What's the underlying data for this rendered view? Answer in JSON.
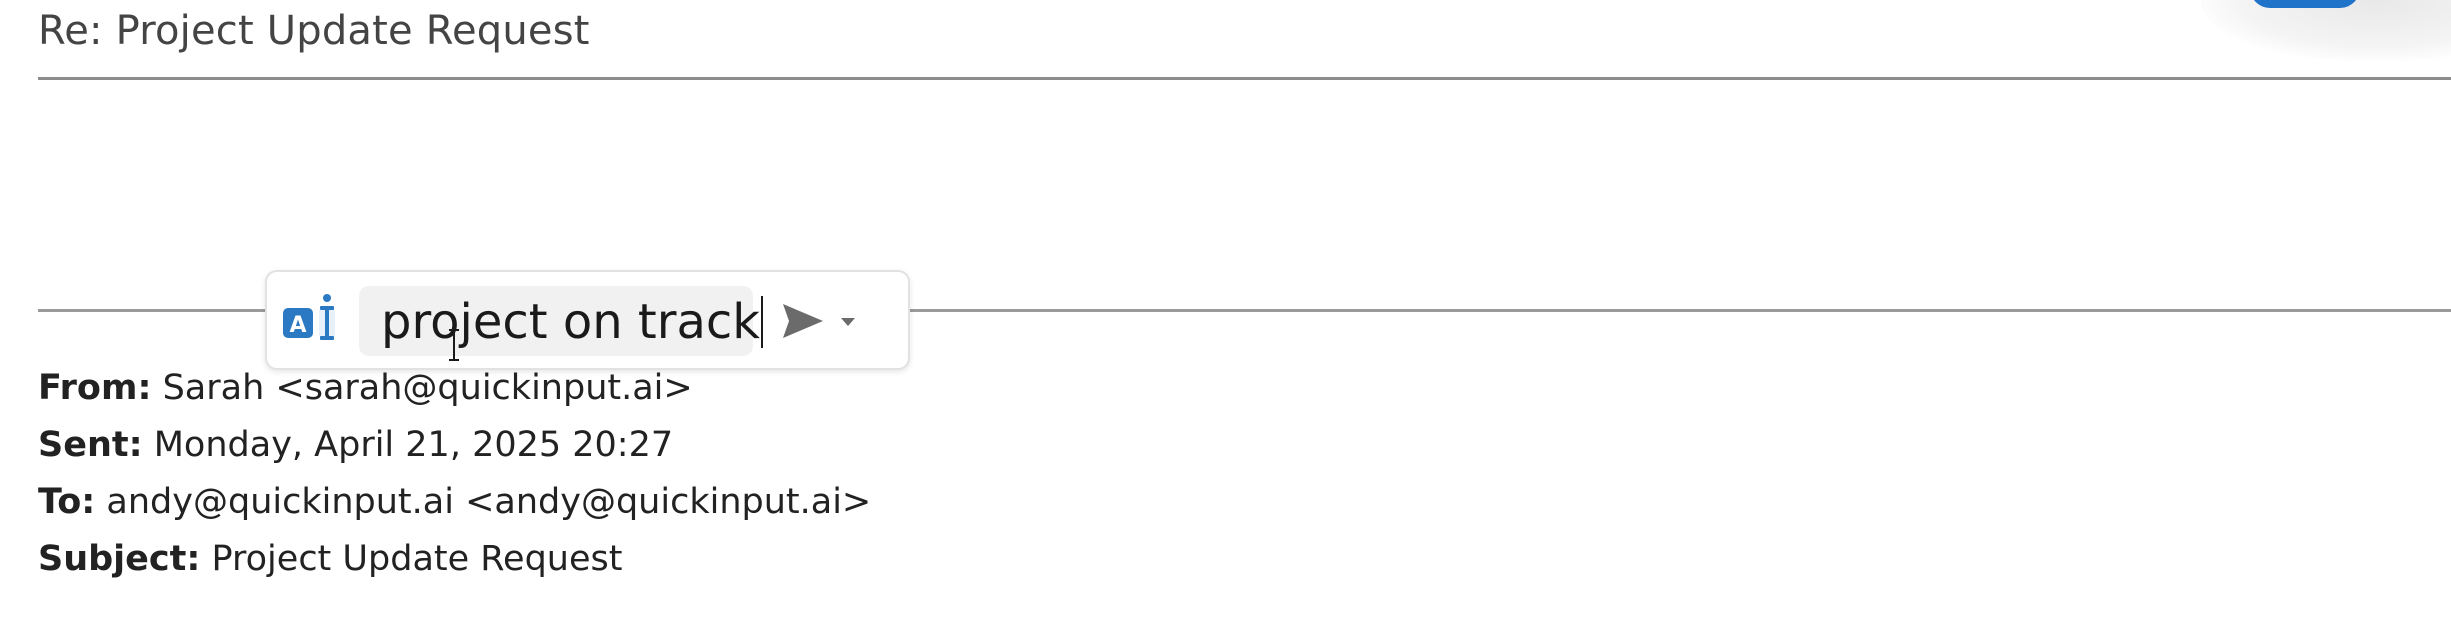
{
  "email": {
    "subject_line": "Re: Project Update Request"
  },
  "quick_input": {
    "prompt_value": "project on track",
    "ai_icon": "ai-text-icon",
    "send_icon": "send-arrow-icon",
    "dropdown_icon": "caret-down-icon"
  },
  "original_message": {
    "from_label": "From:",
    "from_value": "Sarah <sarah@quickinput.ai>",
    "sent_label": "Sent:",
    "sent_value": "Monday, April 21, 2025 20:27",
    "to_label": "To:",
    "to_value": "andy@quickinput.ai <andy@quickinput.ai>",
    "subject_label": "Subject:",
    "subject_value": "Project Update Request"
  },
  "colors": {
    "accent_blue": "#2b79c2",
    "divider": "#8c8c8c",
    "text": "#222222"
  }
}
